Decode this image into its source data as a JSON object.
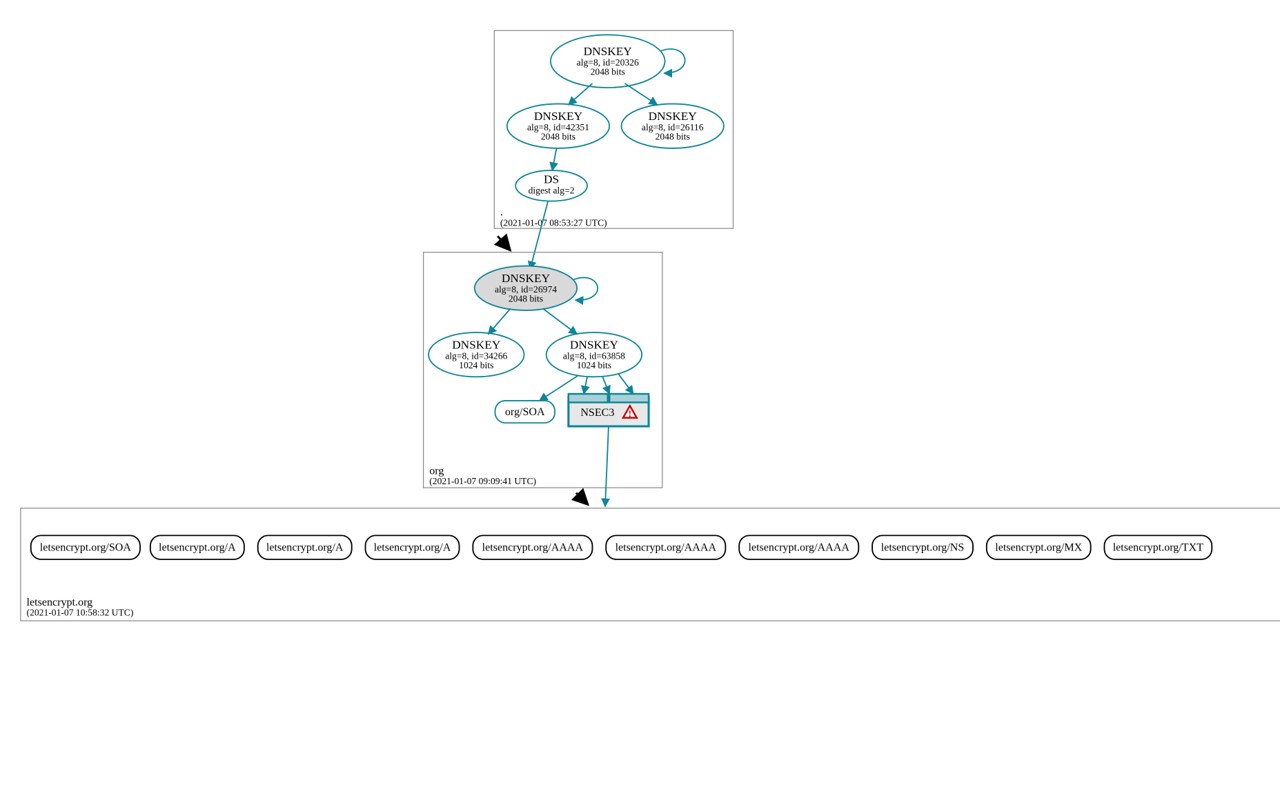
{
  "zones": {
    "root": {
      "label": ".",
      "timestamp": "(2021-01-07 08:53:27 UTC)"
    },
    "org": {
      "label": "org",
      "timestamp": "(2021-01-07 09:09:41 UTC)"
    },
    "le": {
      "label": "letsencrypt.org",
      "timestamp": "(2021-01-07 10:58:32 UTC)"
    }
  },
  "nodes": {
    "root_ksk": {
      "title": "DNSKEY",
      "line2": "alg=8, id=20326",
      "line3": "2048 bits"
    },
    "root_zsk1": {
      "title": "DNSKEY",
      "line2": "alg=8, id=42351",
      "line3": "2048 bits"
    },
    "root_zsk2": {
      "title": "DNSKEY",
      "line2": "alg=8, id=26116",
      "line3": "2048 bits"
    },
    "root_ds": {
      "title": "DS",
      "line2": "digest alg=2"
    },
    "org_ksk": {
      "title": "DNSKEY",
      "line2": "alg=8, id=26974",
      "line3": "2048 bits"
    },
    "org_zsk1": {
      "title": "DNSKEY",
      "line2": "alg=8, id=34266",
      "line3": "1024 bits"
    },
    "org_zsk2": {
      "title": "DNSKEY",
      "line2": "alg=8, id=63858",
      "line3": "1024 bits"
    },
    "org_soa": {
      "title": "org/SOA"
    },
    "nsec3": {
      "title": "NSEC3"
    }
  },
  "records": {
    "r0": "letsencrypt.org/SOA",
    "r1": "letsencrypt.org/A",
    "r2": "letsencrypt.org/A",
    "r3": "letsencrypt.org/A",
    "r4": "letsencrypt.org/AAAA",
    "r5": "letsencrypt.org/AAAA",
    "r6": "letsencrypt.org/AAAA",
    "r7": "letsencrypt.org/NS",
    "r8": "letsencrypt.org/MX",
    "r9": "letsencrypt.org/TXT"
  }
}
